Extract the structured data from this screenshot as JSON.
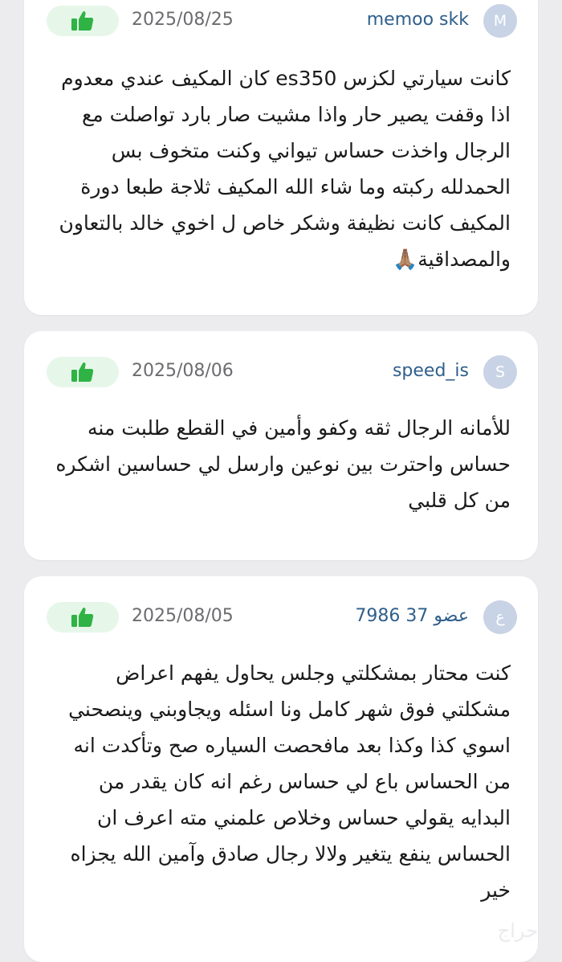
{
  "reviews": [
    {
      "avatar_letter": "M",
      "username": "memoo skk",
      "date": "2025/08/25",
      "text": "كانت سيارتي لكزس es350 كان المكيف عندي معدوم اذا وقفت يصير حار واذا مشيت صار بارد تواصلت مع الرجال واخذت حساس تيواني وكنت متخوف بس الحمدلله ركبته وما شاء الله المكيف ثلاجة طبعا دورة المكيف كانت نظيفة وشكر خاص ل اخوي خالد بالتعاون والمصداقية🙏🏽"
    },
    {
      "avatar_letter": "S",
      "username": "speed_is",
      "date": "2025/08/06",
      "text": "للأمانه الرجال ثقه وكفو وأمين في القطع طلبت منه حساس واحترت بين نوعين وارسل لي حساسين اشكره من كل قلبي"
    },
    {
      "avatar_letter": "ع",
      "username": "عضو 37 7986",
      "date": "2025/08/05",
      "text": "كنت محتار بمشكلتي وجلس يحاول يفهم اعراض مشكلتي فوق شهر كامل ونا اسئله ويجاوبني وينصحني اسوي كذا وكذا بعد مافحصت السياره صح وتأكدت انه من الحساس باع لي حساس رغم انه كان يقدر من البدايه يقولي حساس وخلاص علمني مته اعرف ان الحساس ينفع يتغير ولالا رجال صادق وآمين الله يجزاه خير"
    }
  ],
  "like_icon": "thumbs-up-icon",
  "watermark": "حراج",
  "colors": {
    "like_bg": "#e6f7ea",
    "like_icon": "#2fb344",
    "username": "#2f5f8c",
    "avatar_bg": "#c9d3e6"
  }
}
